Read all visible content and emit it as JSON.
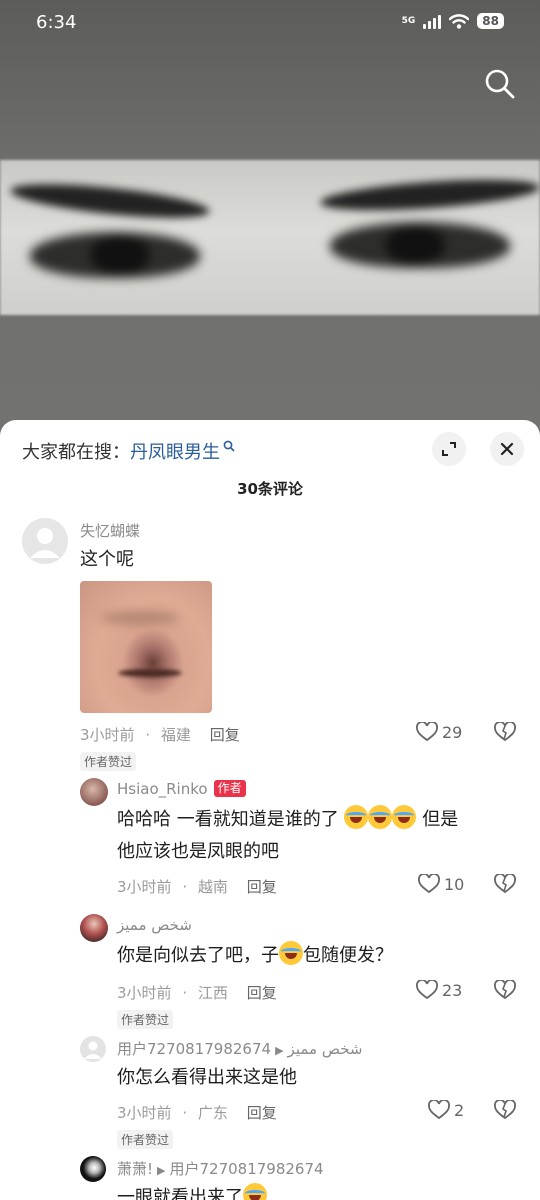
{
  "status": {
    "time": "6:34",
    "network": "5G",
    "battery": "88"
  },
  "sheet": {
    "hot_search_label": "大家都在搜：",
    "hot_search_keyword": "丹凤眼男生",
    "comment_count": "30条评论"
  },
  "comments": [
    {
      "user": "失忆蝴蝶",
      "text": "这个呢",
      "time": "3小时前",
      "location": "福建",
      "reply": "回复",
      "likes": "29",
      "tag": "作者赞过"
    },
    {
      "user": "Hsiao_Rinko",
      "badge": "作者",
      "text_1": "哈哈哈 一看就知道是谁的了",
      "text_2": "但是",
      "text_3": "他应该也是凤眼的吧",
      "time": "3小时前",
      "location": "越南",
      "reply": "回复",
      "likes": "10"
    },
    {
      "user": "شخص مميز",
      "text_1": "你是向似去了吧，子",
      "text_2": "包随便发？",
      "time": "3小时前",
      "location": "江西",
      "reply": "回复",
      "likes": "23",
      "tag": "作者赞过"
    },
    {
      "user": "用户7270817982674",
      "reply_to": "شخص مميز",
      "text": "你怎么看得出来这是他",
      "time": "3小时前",
      "location": "广东",
      "reply": "回复",
      "likes": "2",
      "tag": "作者赞过"
    },
    {
      "user": "萧萧!",
      "reply_to": "用户7270817982674",
      "text": "一眼就看出来了"
    }
  ],
  "separator": "·"
}
